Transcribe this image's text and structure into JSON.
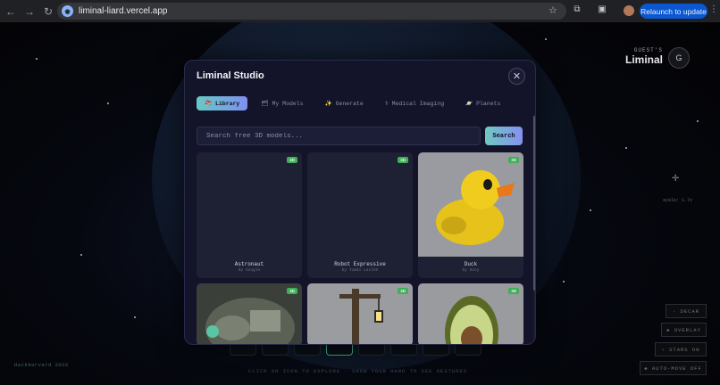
{
  "browser": {
    "url": "liminal-liard.vercel.app",
    "relaunch_label": "Relaunch to update"
  },
  "brand": {
    "subtitle": "GUEST'S",
    "title": "Liminal",
    "avatar_letter": "G"
  },
  "scene": {
    "scale_text": "scale: 1.7x",
    "hint": "CLICK AN ICON TO EXPLORE · SHOW YOUR HAND TO SEE GESTURES",
    "footer_tag": "HackHarvard 2026",
    "side_buttons": [
      "◦ DECAR",
      "◈ OVERLAY",
      "✧ STARS ON",
      "◈ AUTO-MOVE OFF"
    ]
  },
  "modal": {
    "title": "Liminal Studio",
    "tabs": [
      {
        "label": "📚 Library",
        "active": true
      },
      {
        "label": "🗂 My Models",
        "active": false
      },
      {
        "label": "✨ Generate",
        "active": false
      },
      {
        "label": "⚕ Medical Imaging",
        "active": false
      },
      {
        "label": "🪐 Planets",
        "active": false
      }
    ],
    "search": {
      "placeholder": "Search free 3D models...",
      "button_label": "Search"
    },
    "cards": [
      {
        "name": "Astronaut",
        "author": "by Google",
        "badge": "3D"
      },
      {
        "name": "Robot Expressive",
        "author": "by Tomás Laulhé",
        "badge": "3D"
      },
      {
        "name": "Duck",
        "author": "by Sony",
        "badge": "3D"
      },
      {
        "name": "",
        "author": "",
        "badge": "3D"
      },
      {
        "name": "",
        "author": "",
        "badge": "3D"
      },
      {
        "name": "",
        "author": "",
        "badge": "3D"
      }
    ]
  }
}
